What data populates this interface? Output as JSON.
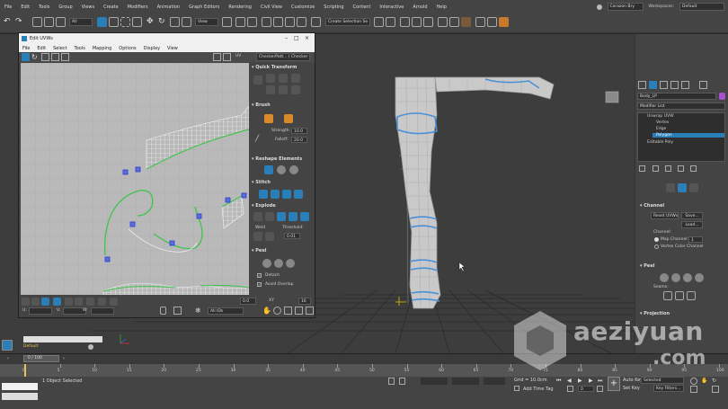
{
  "menubar": {
    "items": [
      "File",
      "Edit",
      "Tools",
      "Group",
      "Views",
      "Create",
      "Modifiers",
      "Animation",
      "Graph Editors",
      "Rendering",
      "Civil View",
      "Customize",
      "Scripting",
      "Content",
      "Interactive",
      "Arnold",
      "Help"
    ],
    "user": "Corazon Bry",
    "workspaces_label": "Workspaces:",
    "workspace_value": "Default"
  },
  "toolbar": {
    "filter_value": "All",
    "view_value": "View",
    "selection_set_value": "Create Selection Se"
  },
  "uv_editor": {
    "title": "Edit UVWs",
    "menu": [
      "File",
      "Edit",
      "Select",
      "Tools",
      "Mapping",
      "Options",
      "Display",
      "View"
    ],
    "uv_label": "UV",
    "texture_dropdown": "CheckerPatt... ( Checker )",
    "sections": {
      "quick_transform": "Quick Transform",
      "brush": "Brush",
      "reshape": "Reshape Elements",
      "stitch": "Stitch",
      "explode": "Explode",
      "peel": "Peel"
    },
    "brush": {
      "strength_label": "Strength:",
      "strength_value": "10.0",
      "falloff_label": "Falloff:",
      "falloff_value": "20.0"
    },
    "explode": {
      "weld_label": "Weld",
      "threshold_label": "Threshold:",
      "threshold_value": "0.01"
    },
    "peel": {
      "detach_label": "Detach",
      "avoid_overlap_label": "Avoid Overlap"
    },
    "bottom": {
      "value1": "0.0",
      "xy_label": "XY",
      "value2": "16",
      "u_label": "U:",
      "v_label": "V:",
      "w_label": "W:",
      "all_ids_value": "All IDs"
    }
  },
  "command_panel": {
    "object_name": "Body_LP",
    "modifier_list": "Modifier List",
    "stack": [
      "Unwrap UVW",
      "Vertex",
      "Edge",
      "Polygon",
      "Editable Poly"
    ],
    "stack_selected_index": 3,
    "channel": {
      "header": "Channel",
      "reset_uvws": "Reset UVWs",
      "save": "Save...",
      "load": "Load...",
      "channel_label": "Channel:",
      "map_channel_label": "Map Channel:",
      "map_channel_value": "1",
      "vertex_color_channel": "Vertex Color Channel"
    },
    "peel_header": "Peel",
    "seams_label": "Seams:",
    "projection_header": "Projection"
  },
  "layer": {
    "name": "Default"
  },
  "timeline": {
    "frame_counter": "0 / 100",
    "ticks": [
      "0",
      "5",
      "10",
      "15",
      "20",
      "25",
      "30",
      "35",
      "40",
      "45",
      "50",
      "55",
      "60",
      "65",
      "70",
      "75",
      "80",
      "85",
      "90",
      "95",
      "100"
    ]
  },
  "status": {
    "selection_text": "1 Object Selected",
    "grid_text": "Grid = 10.0cm",
    "add_time_tag": "Add Time Tag",
    "auto_key": "Auto Key",
    "set_key": "Set Key",
    "selected_value": "Selected",
    "key_filters": "Key Filters...",
    "frame_value": "0"
  },
  "watermark": {
    "line1": "aeziyuan",
    "line2": ".com"
  },
  "colors": {
    "accent_blue": "#2a7fb8",
    "selection_blue": "#4a90d9",
    "seam_green": "#3fc34a",
    "uv_vertex_blue": "#2b3cc8"
  }
}
